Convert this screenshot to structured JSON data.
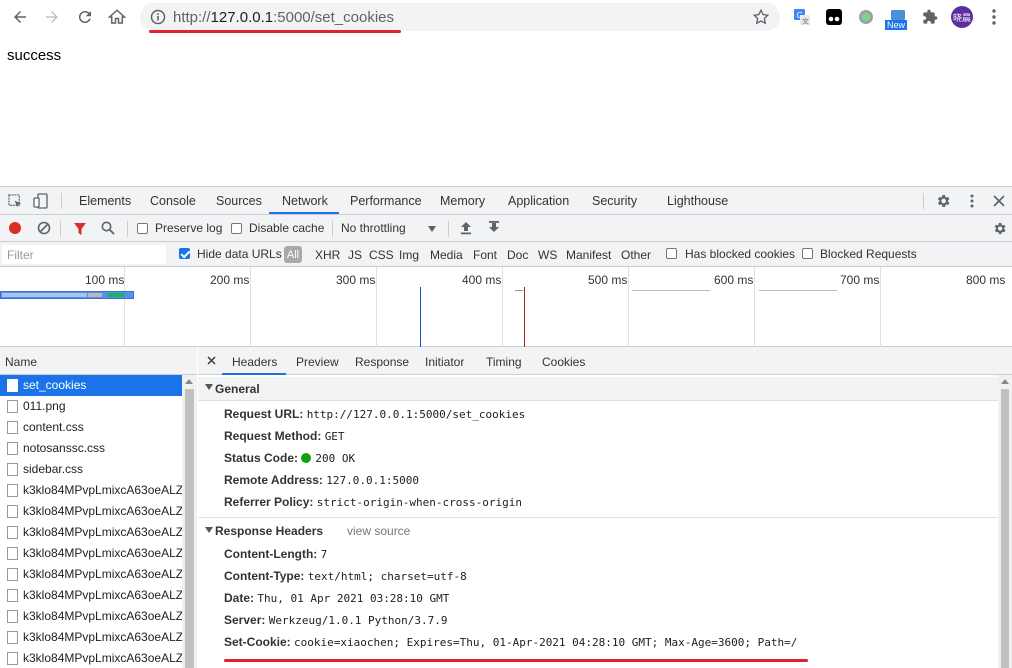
{
  "browser": {
    "url_prefix": "http://",
    "url_host": "127.0.0.1",
    "url_rest": ":5000/set_cookies",
    "avatar_text": "晓晨",
    "new_badge": "New"
  },
  "page": {
    "body_text": "success"
  },
  "devtools": {
    "tabs": [
      "Elements",
      "Console",
      "Sources",
      "Network",
      "Performance",
      "Memory",
      "Application",
      "Security",
      "Lighthouse"
    ],
    "active_tab": "Network",
    "toolbar": {
      "preserve_log": "Preserve log",
      "disable_cache": "Disable cache",
      "throttling": "No throttling"
    },
    "filter": {
      "placeholder": "Filter",
      "hide_data_urls": "Hide data URLs",
      "all": "All",
      "types": [
        "XHR",
        "JS",
        "CSS",
        "Img",
        "Media",
        "Font",
        "Doc",
        "WS",
        "Manifest",
        "Other"
      ],
      "has_blocked_cookies": "Has blocked cookies",
      "blocked_requests": "Blocked Requests"
    },
    "timeline": {
      "ticks": [
        "100 ms",
        "200 ms",
        "300 ms",
        "400 ms",
        "500 ms",
        "600 ms",
        "700 ms",
        "800 ms"
      ]
    },
    "requests": {
      "header": "Name",
      "items": [
        "set_cookies",
        "011.png",
        "content.css",
        "notosanssc.css",
        "sidebar.css",
        "k3klo84MPvpLmixcA63oeALZ",
        "k3klo84MPvpLmixcA63oeALZ",
        "k3klo84MPvpLmixcA63oeALZ",
        "k3klo84MPvpLmixcA63oeALZ",
        "k3klo84MPvpLmixcA63oeALZ",
        "k3klo84MPvpLmixcA63oeALZ",
        "k3klo84MPvpLmixcA63oeALZ",
        "k3klo84MPvpLmixcA63oeALZ",
        "k3klo84MPvpLmixcA63oeALZ"
      ],
      "selected_index": 0
    },
    "detail_tabs": [
      "Headers",
      "Preview",
      "Response",
      "Initiator",
      "Timing",
      "Cookies"
    ],
    "active_detail_tab": "Headers",
    "general": {
      "title": "General",
      "rows": [
        {
          "k": "Request URL:",
          "v": "http://127.0.0.1:5000/set_cookies"
        },
        {
          "k": "Request Method:",
          "v": "GET"
        },
        {
          "k": "Status Code:",
          "v": "200 OK"
        },
        {
          "k": "Remote Address:",
          "v": "127.0.0.1:5000"
        },
        {
          "k": "Referrer Policy:",
          "v": "strict-origin-when-cross-origin"
        }
      ]
    },
    "response_headers": {
      "title": "Response Headers",
      "view_source": "view source",
      "rows": [
        {
          "k": "Content-Length:",
          "v": "7"
        },
        {
          "k": "Content-Type:",
          "v": "text/html; charset=utf-8"
        },
        {
          "k": "Date:",
          "v": "Thu, 01 Apr 2021 03:28:10 GMT"
        },
        {
          "k": "Server:",
          "v": "Werkzeug/1.0.1 Python/3.7.9"
        },
        {
          "k": "Set-Cookie:",
          "v": "cookie=xiaochen; Expires=Thu, 01-Apr-2021 04:28:10 GMT; Max-Age=3600; Path=/"
        }
      ]
    }
  },
  "colors": {
    "annotation_red": "#e0242d",
    "accent_blue": "#1a73e8",
    "status_green": "#0ca30c"
  }
}
